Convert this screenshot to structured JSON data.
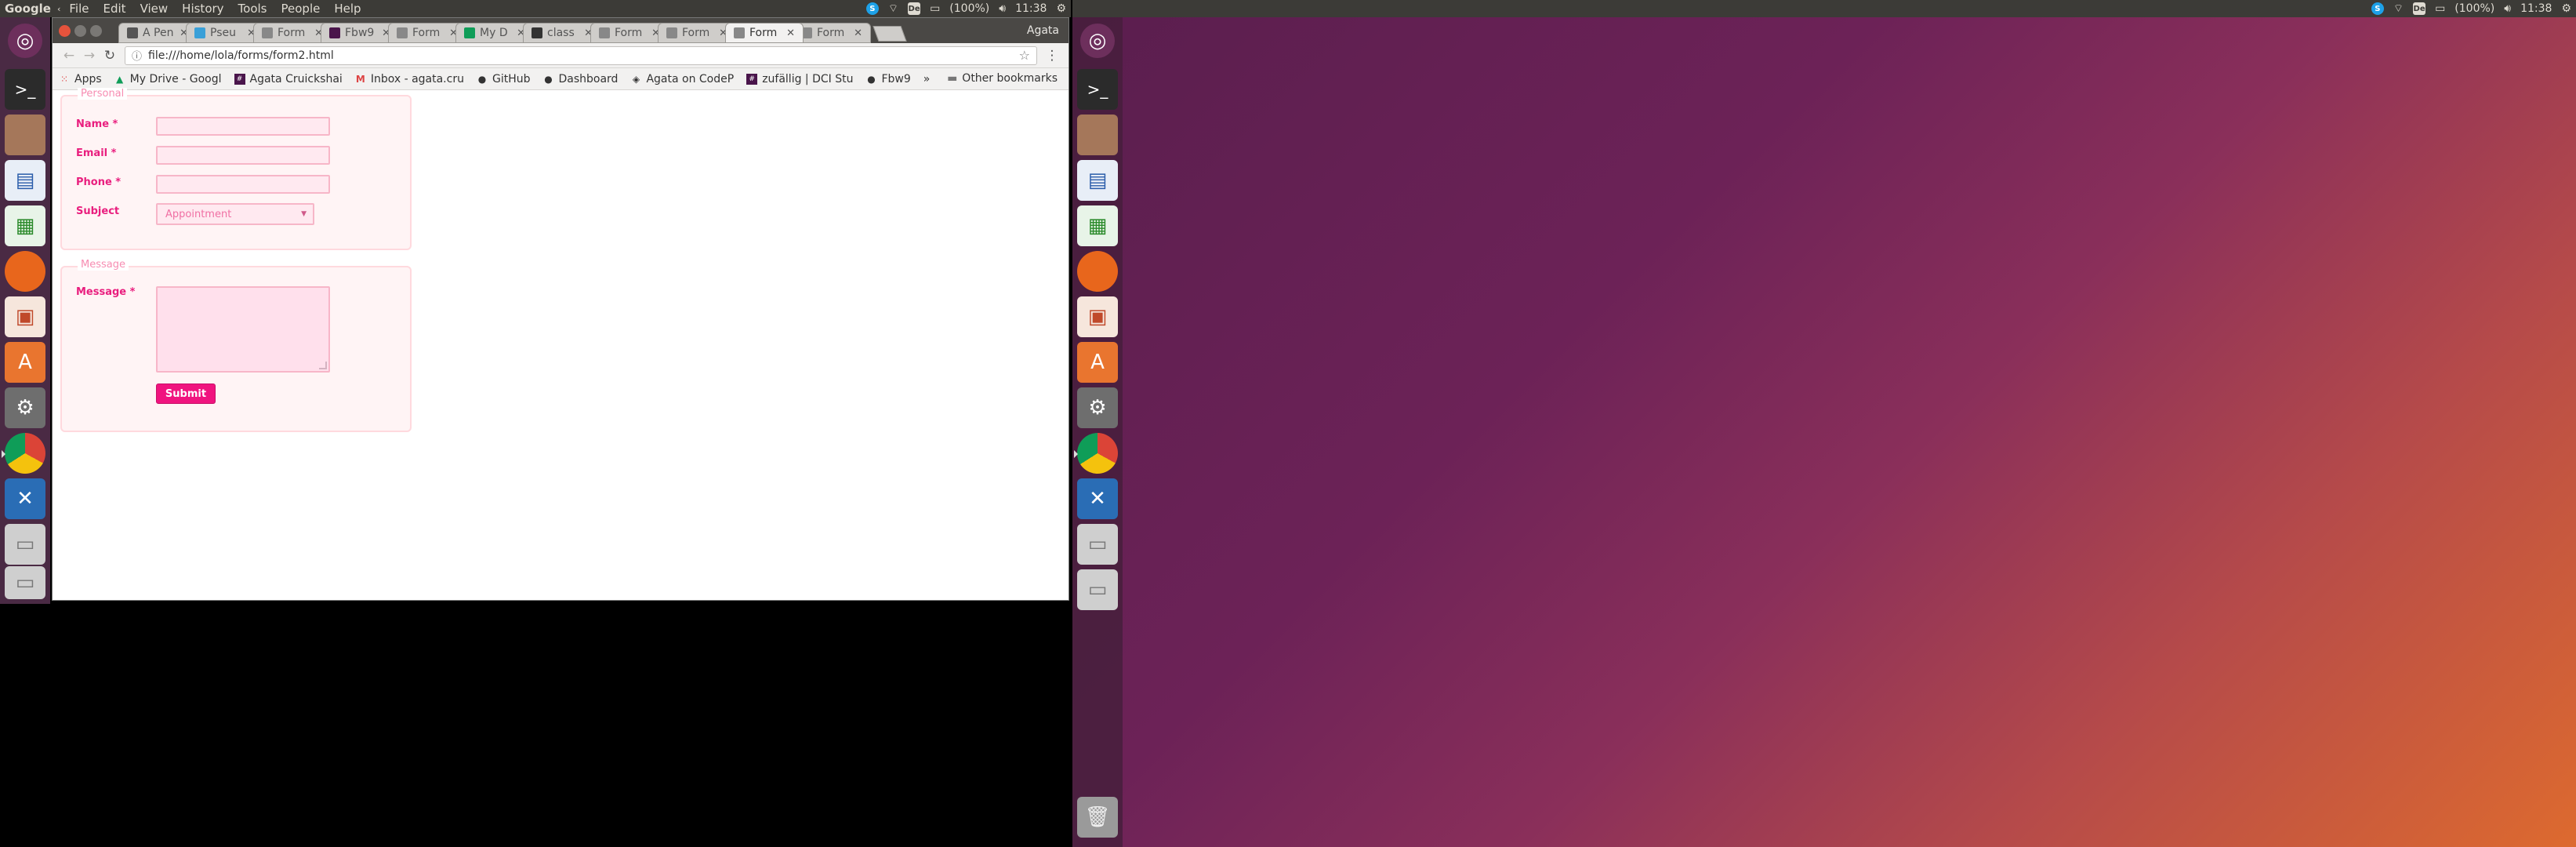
{
  "left_topbar": {
    "app_name": "Google",
    "menu": [
      "File",
      "Edit",
      "View",
      "History",
      "Tools",
      "People",
      "Help"
    ],
    "battery": "(100%)",
    "clock": "11:38"
  },
  "right_topbar": {
    "battery": "(100%)",
    "clock": "11:38"
  },
  "indicator_de": "De",
  "indicator_skype": "S",
  "browser": {
    "profile": "Agata",
    "tabs": [
      {
        "title": "A Pen",
        "active": false
      },
      {
        "title": "Pseu",
        "active": false
      },
      {
        "title": "Form",
        "active": false
      },
      {
        "title": "Fbw9",
        "active": false
      },
      {
        "title": "Form",
        "active": false
      },
      {
        "title": "My D",
        "active": false
      },
      {
        "title": "class",
        "active": false
      },
      {
        "title": "Form",
        "active": false
      },
      {
        "title": "Form",
        "active": false
      },
      {
        "title": "Form",
        "active": true
      },
      {
        "title": "Form",
        "active": false
      }
    ],
    "url": "file:///home/lola/forms/form2.html",
    "bookmarks": {
      "apps": "Apps",
      "items": [
        "My Drive - Googl",
        "Agata Cruickshai",
        "Inbox - agata.cru",
        "GitHub",
        "Dashboard",
        "Agata on CodeP",
        "zufällig | DCI Stu",
        "Fbw9"
      ],
      "overflow": "»",
      "other": "Other bookmarks"
    }
  },
  "form": {
    "personal_legend": "Personal",
    "name_label": "Name *",
    "email_label": "Email *",
    "phone_label": "Phone *",
    "subject_label": "Subject",
    "subject_value": "Appointment",
    "message_legend": "Message",
    "message_label": "Message *",
    "submit_label": "Submit"
  },
  "colors": {
    "accent": "#f0147f",
    "label": "#e91e7e",
    "field_border": "#f7b6c8",
    "fieldset_border": "#ffd9de"
  }
}
